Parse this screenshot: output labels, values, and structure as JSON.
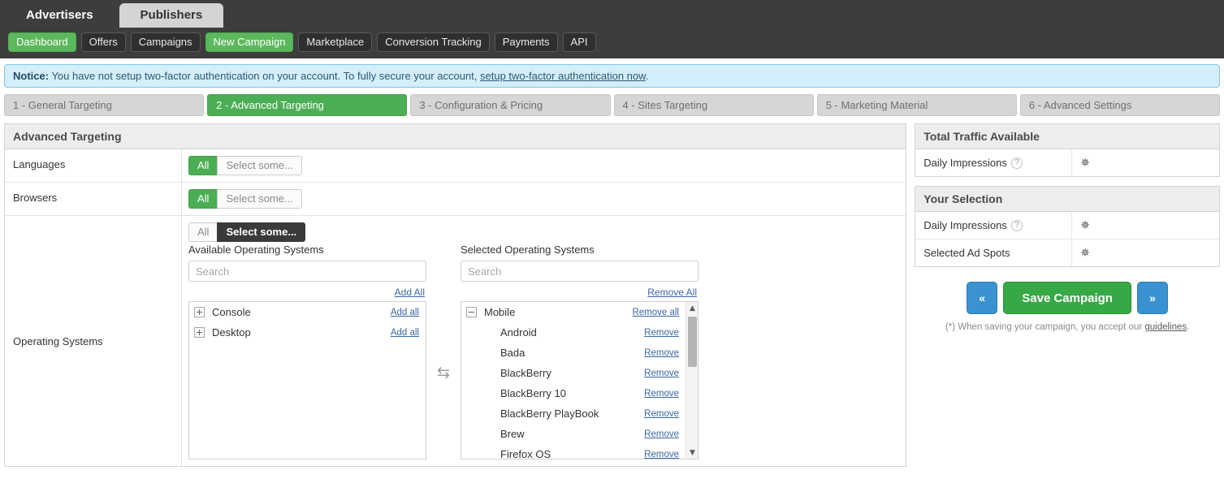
{
  "account_tabs": [
    {
      "label": "Advertisers",
      "active": true
    },
    {
      "label": "Publishers",
      "active": false
    }
  ],
  "nav": [
    {
      "label": "Dashboard",
      "style": "green"
    },
    {
      "label": "Offers",
      "style": "dark"
    },
    {
      "label": "Campaigns",
      "style": "dark"
    },
    {
      "label": "New Campaign",
      "style": "green"
    },
    {
      "label": "Marketplace",
      "style": "dark"
    },
    {
      "label": "Conversion Tracking",
      "style": "dark"
    },
    {
      "label": "Payments",
      "style": "dark"
    },
    {
      "label": "API",
      "style": "dark"
    }
  ],
  "notice": {
    "prefix": "Notice:",
    "text": " You have not setup two-factor authentication on your account. To fully secure your account, ",
    "link": "setup two-factor authentication now",
    "suffix": "."
  },
  "steps": [
    {
      "label": "1 - General Targeting",
      "active": false
    },
    {
      "label": "2 - Advanced Targeting",
      "active": true
    },
    {
      "label": "3 - Configuration & Pricing",
      "active": false
    },
    {
      "label": "4 - Sites Targeting",
      "active": false
    },
    {
      "label": "5 - Marketing Material",
      "active": false
    },
    {
      "label": "6 - Advanced Settings",
      "active": false
    }
  ],
  "main_panel": {
    "title": "Advanced Targeting",
    "rows": {
      "languages": {
        "label": "Languages",
        "all_label": "All",
        "some_label": "Select some...",
        "selected": "all"
      },
      "browsers": {
        "label": "Browsers",
        "all_label": "All",
        "some_label": "Select some...",
        "selected": "all"
      },
      "operating_systems": {
        "label": "Operating Systems",
        "all_label": "All",
        "some_label": "Select some...",
        "selected": "some"
      }
    }
  },
  "dual_list": {
    "available": {
      "title": "Available Operating Systems",
      "search_placeholder": "Search",
      "bulk_action": "Add All",
      "group_action": "Add all",
      "groups": [
        {
          "name": "Console",
          "expander": "+",
          "action": "Add all"
        },
        {
          "name": "Desktop",
          "expander": "+",
          "action": "Add all"
        }
      ]
    },
    "transfer_icon": "transfer-arrows",
    "selected": {
      "title": "Selected Operating Systems",
      "search_placeholder": "Search",
      "bulk_action": "Remove All",
      "group": {
        "name": "Mobile",
        "expander": "−",
        "action": "Remove all"
      },
      "item_action": "Remove",
      "items": [
        "Android",
        "Bada",
        "BlackBerry",
        "BlackBerry 10",
        "BlackBerry PlayBook",
        "Brew",
        "Firefox OS"
      ]
    }
  },
  "sidebar": {
    "total_traffic": {
      "title": "Total Traffic Available",
      "rows": [
        {
          "label": "Daily Impressions",
          "help": "?",
          "value": "loading"
        }
      ]
    },
    "your_selection": {
      "title": "Your Selection",
      "rows": [
        {
          "label": "Daily Impressions",
          "help": "?",
          "value": "loading"
        },
        {
          "label": "Selected Ad Spots",
          "help": "",
          "value": "loading"
        }
      ]
    },
    "actions": {
      "prev_label": "«",
      "save_label": "Save Campaign",
      "next_label": "»"
    },
    "guidelines": {
      "prefix": "(*) When saving your campaign, you accept our ",
      "link": "guidelines",
      "suffix": "."
    }
  },
  "colors": {
    "green": "#5cb85c",
    "step_green": "#4cae54",
    "save_green": "#36a845",
    "blue": "#3a93d0",
    "dark": "#3d3d3d",
    "notice_bg": "#d4eefb",
    "link": "#3a67a8"
  }
}
